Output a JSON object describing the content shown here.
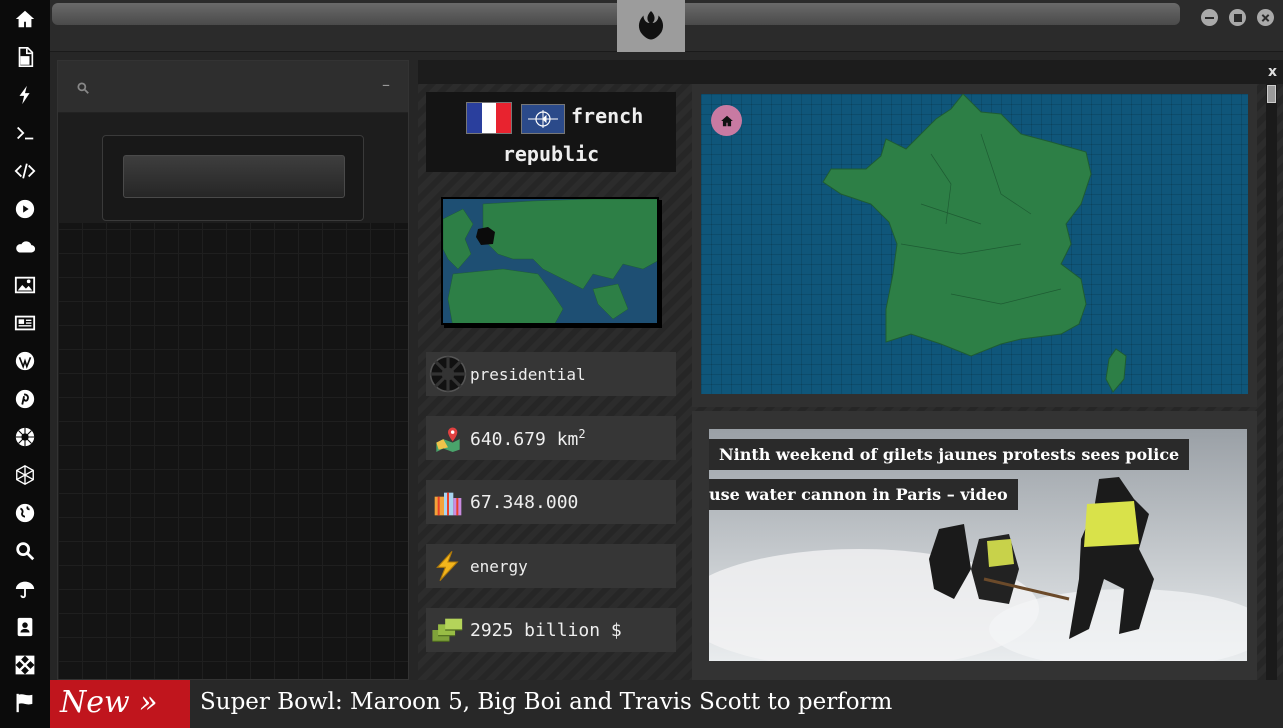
{
  "sidebar": {
    "icons": [
      "home-icon",
      "document-icon",
      "lightning-icon",
      "terminal-icon",
      "code-icon",
      "play-icon",
      "cloud-icon",
      "image-icon",
      "newspaper-icon",
      "wordpress-icon",
      "pinterest-icon",
      "rebel-alliance-icon",
      "geodesic-icon",
      "globe-icon",
      "search-icon",
      "umbrella-icon",
      "contacts-icon",
      "expand-icon",
      "flag-icon"
    ]
  },
  "window": {
    "controls": [
      "minimize",
      "maximize",
      "close"
    ]
  },
  "left_panel": {
    "collapse_label": "–"
  },
  "country": {
    "name_line1": "french",
    "name_line2": "republic",
    "flag_colors": [
      "#2a3f9d",
      "#ffffff",
      "#e8232f"
    ],
    "government": "presidential",
    "area_value": "640.679 km",
    "area_unit_sup": "2",
    "population": "67.348.000",
    "resource": "energy",
    "gdp": "2925 billion $"
  },
  "main_panel": {
    "close_label": "x"
  },
  "news": {
    "headline_line1": "Ninth weekend of gilets jaunes protests sees police",
    "headline_line2": "use water cannon in Paris – video"
  },
  "ticker": {
    "badge": "New »",
    "text": "Super Bowl: Maroon 5, Big Boi and Travis Scott to perform"
  },
  "colors": {
    "accent_red": "#c0151d",
    "map_sea": "#0f567a",
    "map_land": "#2d7f46",
    "home_pink": "#c87aa2"
  }
}
